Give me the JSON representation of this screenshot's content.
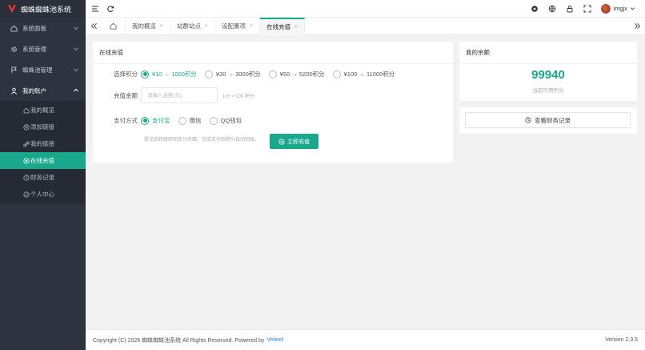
{
  "app": {
    "title": "蜘蛛蜘蛛池系统"
  },
  "sidebar": {
    "items": [
      {
        "label": "系统面板",
        "icon": "home-icon"
      },
      {
        "label": "系统管理",
        "icon": "gear-icon"
      },
      {
        "label": "蜘蛛池管理",
        "icon": "flag-icon"
      },
      {
        "label": "我的账户",
        "icon": "user-icon"
      }
    ],
    "submenu": [
      {
        "label": "我的概览",
        "icon": "home-outline-icon"
      },
      {
        "label": "添加链接",
        "icon": "plus-circle-icon"
      },
      {
        "label": "我的链接",
        "icon": "link-icon"
      },
      {
        "label": "在线充值",
        "icon": "coin-icon"
      },
      {
        "label": "财务记录",
        "icon": "clock-icon"
      },
      {
        "label": "个人中心",
        "icon": "check-circle-icon"
      }
    ]
  },
  "topbar": {
    "username": "imgjx"
  },
  "tabs": [
    {
      "label": "我的概览"
    },
    {
      "label": "站群站点"
    },
    {
      "label": "设配置项"
    },
    {
      "label": "在线充值"
    }
  ],
  "recharge": {
    "title": "在线充值",
    "package_label": "选择积分",
    "packages": [
      "¥10 → 1000积分",
      "¥30 → 3000积分",
      "¥50 → 5200积分",
      "¥100 → 11000积分"
    ],
    "amount_label": "充值金额",
    "amount_placeholder": "请输入金额(元)",
    "amount_hint": "1元 = 100 积分",
    "method_label": "支付方式",
    "methods": [
      "支付宝",
      "微信",
      "QQ钱包"
    ],
    "note": "提交后将跳转到支付页面，完成支付后积分自动到账。",
    "submit_label": "立即充值"
  },
  "balance": {
    "title": "我的余额",
    "value": "99940",
    "label": "当前可用积分"
  },
  "records": {
    "button_label": "查看财务记录"
  },
  "footer": {
    "copyright": "Copyright (C) 2026 蜘蛛蜘蛛池系统 All Rights Reserved. Powered by",
    "link": "Veitool",
    "version": "Version 2.3.5"
  },
  "colors": {
    "accent": "#1aa88d",
    "sidebar": "#2e3340",
    "logo": "#e03a3a"
  }
}
